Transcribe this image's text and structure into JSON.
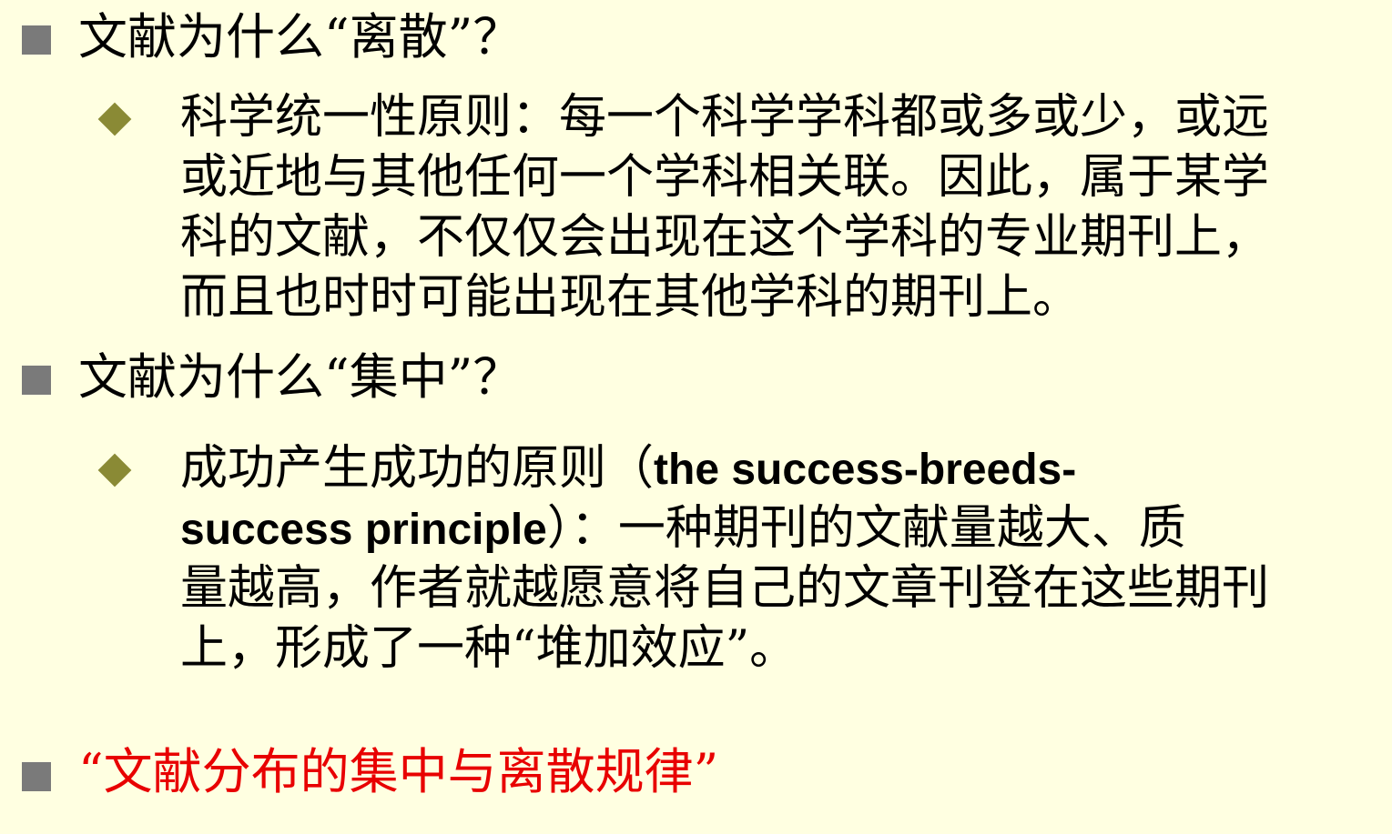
{
  "section1": {
    "heading": "文献为什么“离散”？",
    "item": {
      "lines": [
        "科学统一性原则：每一个科学学科都或多或少，或远",
        "或近地与其他任何一个学科相关联。因此，属于某学",
        "科的文献，不仅仅会出现在这个学科的专业期刊上，",
        "而且也时时可能出现在其他学科的期刊上。"
      ]
    }
  },
  "section2": {
    "heading": "文献为什么“集中”？",
    "item": {
      "line1_cn": "成功产生成功的原则（",
      "line1_en": "the success-breeds-",
      "line2_en": "success principle",
      "line2_cn": "）：一种期刊的文献量越大、质",
      "line3": "量越高，作者就越愿意将自己的文章刊登在这些期刊",
      "line4": "上，形成了一种“堆加效应”。"
    }
  },
  "section3": {
    "heading": "“文献分布的集中与离散规律”"
  },
  "colors": {
    "background": "#FFFFE1",
    "bullet_square": "#7A7A7A",
    "bullet_diamond": "#8A8A35",
    "highlight": "#E80000"
  },
  "icons": {
    "level1_bullet": "square-bullet-icon",
    "level2_bullet": "diamond-bullet-icon"
  }
}
